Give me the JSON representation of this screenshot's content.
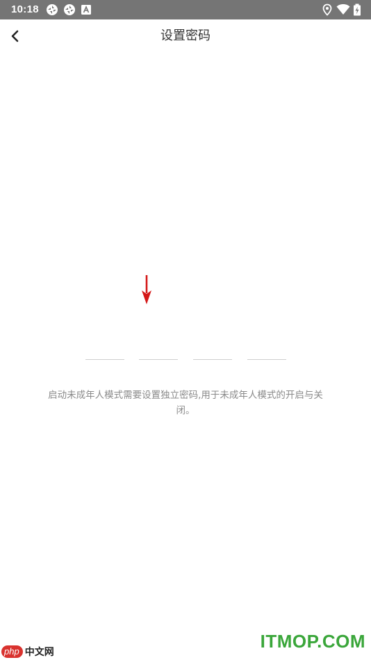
{
  "status_bar": {
    "time": "10:18",
    "icons": [
      "sync-icon",
      "sync-icon",
      "font-a-icon",
      "location-icon",
      "wifi-icon",
      "battery-charging-icon"
    ]
  },
  "app_bar": {
    "title": "设置密码",
    "back_icon": "chevron-left-icon"
  },
  "pin": {
    "slots": [
      "",
      "",
      "",
      ""
    ]
  },
  "hint": "启动未成年人模式需要设置独立密码,用于未成年人模式的开启与关闭。",
  "watermarks": {
    "left_logo": "php",
    "left_text": "中文网",
    "right_text": "ITMOP.COM"
  },
  "colors": {
    "status_bar": "#757575",
    "title": "#333333",
    "hint": "#8a8a8a",
    "arrow": "#d41818",
    "watermark_green": "#3aa63a"
  }
}
